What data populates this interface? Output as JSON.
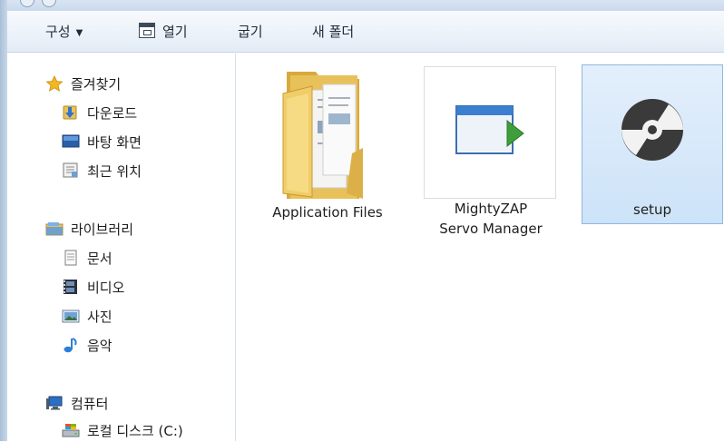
{
  "toolbar": {
    "organize_label": "구성",
    "open_label": "열기",
    "burn_label": "굽기",
    "new_folder_label": "새 폴더"
  },
  "nav": {
    "favorites": {
      "label": "즐겨찾기",
      "items": [
        {
          "label": "다운로드",
          "icon": "downloads-icon"
        },
        {
          "label": "바탕 화면",
          "icon": "desktop-icon"
        },
        {
          "label": "최근 위치",
          "icon": "recent-places-icon"
        }
      ]
    },
    "libraries": {
      "label": "라이브러리",
      "items": [
        {
          "label": "문서",
          "icon": "documents-icon"
        },
        {
          "label": "비디오",
          "icon": "videos-icon"
        },
        {
          "label": "사진",
          "icon": "pictures-icon"
        },
        {
          "label": "음악",
          "icon": "music-icon"
        }
      ]
    },
    "computer": {
      "label": "컴퓨터",
      "items": [
        {
          "label": "로컬 디스크 (C:)",
          "icon": "local-disk-icon"
        }
      ]
    }
  },
  "files": [
    {
      "name": "Application Files",
      "type": "folder"
    },
    {
      "name_line1": "MightyZAP",
      "name_line2": "Servo Manager",
      "type": "application"
    },
    {
      "name": "setup",
      "type": "setup",
      "selected": true
    }
  ],
  "colors": {
    "selection_fill": "#cde3f8",
    "selection_border": "#8fb7e0",
    "folder_yellow": "#e8c15a",
    "toolbar_bg": "#e3ecf6"
  }
}
